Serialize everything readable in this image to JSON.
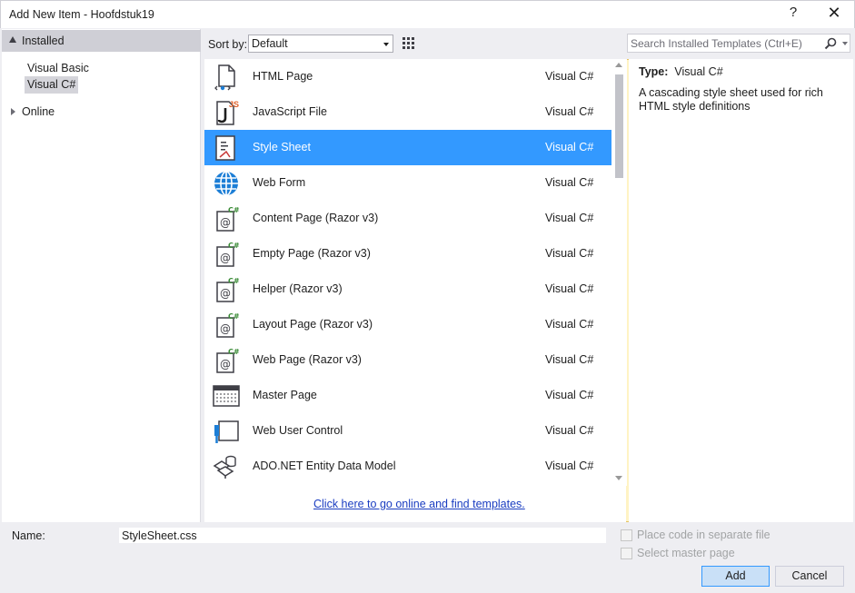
{
  "window": {
    "title": "Add New Item - Hoofdstuk19",
    "help_label": "?",
    "close_label": "✕"
  },
  "tree": {
    "installed_label": "Installed",
    "children": [
      {
        "label": "Visual Basic",
        "selected": false
      },
      {
        "label": "Visual C#",
        "selected": true
      }
    ],
    "online_label": "Online"
  },
  "toolbar": {
    "sort_label": "Sort by:",
    "sort_value": "Default",
    "search_placeholder": "Search Installed Templates (Ctrl+E)"
  },
  "templates": [
    {
      "name": "HTML Page",
      "lang": "Visual C#",
      "icon": "html-page-icon"
    },
    {
      "name": "JavaScript File",
      "lang": "Visual C#",
      "icon": "javascript-file-icon"
    },
    {
      "name": "Style Sheet",
      "lang": "Visual C#",
      "icon": "style-sheet-icon",
      "selected": true
    },
    {
      "name": "Web Form",
      "lang": "Visual C#",
      "icon": "web-form-icon"
    },
    {
      "name": "Content Page (Razor v3)",
      "lang": "Visual C#",
      "icon": "razor-page-icon"
    },
    {
      "name": "Empty Page (Razor v3)",
      "lang": "Visual C#",
      "icon": "razor-page-icon"
    },
    {
      "name": "Helper (Razor v3)",
      "lang": "Visual C#",
      "icon": "razor-page-icon"
    },
    {
      "name": "Layout Page (Razor v3)",
      "lang": "Visual C#",
      "icon": "razor-page-icon"
    },
    {
      "name": "Web Page (Razor v3)",
      "lang": "Visual C#",
      "icon": "razor-page-icon"
    },
    {
      "name": "Master Page",
      "lang": "Visual C#",
      "icon": "master-page-icon"
    },
    {
      "name": "Web User Control",
      "lang": "Visual C#",
      "icon": "web-user-control-icon"
    },
    {
      "name": "ADO.NET Entity Data Model",
      "lang": "Visual C#",
      "icon": "entity-data-model-icon"
    }
  ],
  "online_link": "Click here to go online and find templates.",
  "details": {
    "type_label": "Type:",
    "type_value": "Visual C#",
    "description": "A cascading style sheet used for rich HTML style definitions"
  },
  "bottom": {
    "name_label": "Name:",
    "name_value": "StyleSheet.css",
    "place_code_label": "Place code in separate file",
    "select_master_label": "Select master page",
    "add_label": "Add",
    "cancel_label": "Cancel"
  },
  "colors": {
    "selection": "#3399ff",
    "link": "#1a3dc1",
    "accent_js": "#e0622a",
    "razor_green": "#388a34"
  }
}
